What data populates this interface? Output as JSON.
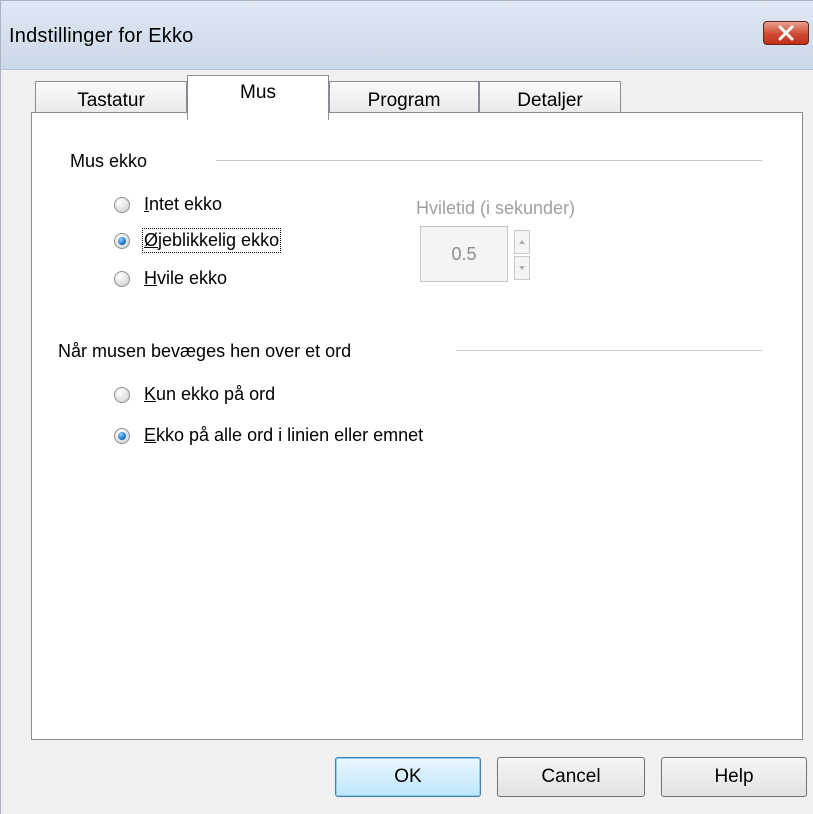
{
  "window": {
    "title": "Indstillinger for Ekko"
  },
  "tabs": [
    {
      "label": "Tastatur",
      "active": false
    },
    {
      "label": "Mus",
      "active": true
    },
    {
      "label": "Program",
      "active": false
    },
    {
      "label": "Detaljer",
      "active": false
    }
  ],
  "mouse_echo": {
    "group_label": "Mus ekko",
    "options": [
      {
        "label_mnemonic": "I",
        "label_rest": "ntet ekko",
        "checked": false
      },
      {
        "label_mnemonic": "Ø",
        "label_rest": "jeblikkelig ekko",
        "checked": true
      },
      {
        "label_mnemonic": "H",
        "label_rest": "vile ekko",
        "checked": false
      }
    ],
    "rest_time_label": "Hviletid (i sekunder)",
    "rest_time_value": "0.5",
    "rest_time_enabled": false
  },
  "hover_word": {
    "group_label": "Når musen bevæges hen over et ord",
    "options": [
      {
        "label_mnemonic": "K",
        "label_rest": "un ekko på ord",
        "checked": false
      },
      {
        "label_mnemonic": "E",
        "label_rest": "kko på alle ord i linien eller emnet",
        "checked": true
      }
    ]
  },
  "buttons": {
    "ok": "OK",
    "cancel": "Cancel",
    "help": "Help"
  },
  "colors": {
    "title_gradient_top": "#dfe8f3",
    "title_gradient_bottom": "#cbd8e8",
    "close_button": "#c1301a",
    "radio_checked": "#1770c5",
    "disabled_text": "#a0a0a0"
  }
}
